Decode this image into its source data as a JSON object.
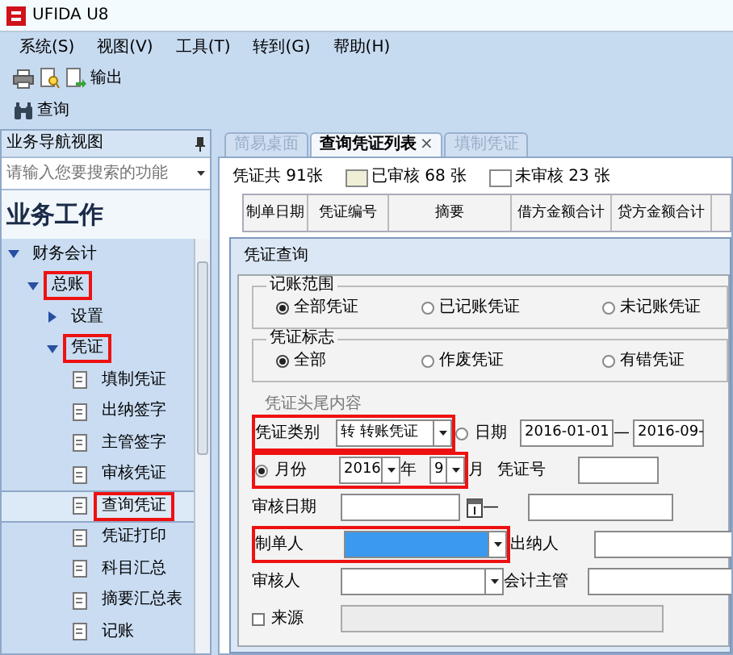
{
  "window": {
    "title": "UFIDA U8"
  },
  "menu": [
    "系统(S)",
    "视图(V)",
    "工具(T)",
    "转到(G)",
    "帮助(H)"
  ],
  "toolbar": [
    {
      "kind": "print"
    },
    {
      "kind": "preview"
    },
    {
      "kind": "export",
      "label": "输出"
    }
  ],
  "toolbar2": [
    {
      "kind": "find",
      "label": "查询"
    }
  ],
  "nav": {
    "title": "业务导航视图",
    "search_placeholder": "请输入您要搜索的功能",
    "section": "业务工作",
    "tree": [
      {
        "kind": "folder",
        "label": "财务会计",
        "expanded": true,
        "highlighted": false,
        "children": [
          {
            "kind": "folder",
            "label": "总账",
            "expanded": true,
            "highlighted": true,
            "children": [
              {
                "kind": "folder",
                "label": "设置",
                "expanded": false,
                "highlighted": false
              },
              {
                "kind": "folder",
                "label": "凭证",
                "expanded": true,
                "highlighted": true,
                "children": [
                  {
                    "kind": "item",
                    "label": "填制凭证",
                    "selected": false,
                    "highlighted": false
                  },
                  {
                    "kind": "item",
                    "label": "出纳签字",
                    "selected": false,
                    "highlighted": false
                  },
                  {
                    "kind": "item",
                    "label": "主管签字",
                    "selected": false,
                    "highlighted": false
                  },
                  {
                    "kind": "item",
                    "label": "审核凭证",
                    "selected": false,
                    "highlighted": false
                  },
                  {
                    "kind": "item",
                    "label": "查询凭证",
                    "selected": true,
                    "highlighted": true
                  },
                  {
                    "kind": "item",
                    "label": "凭证打印",
                    "selected": false,
                    "highlighted": false
                  },
                  {
                    "kind": "item",
                    "label": "科目汇总",
                    "selected": false,
                    "highlighted": false
                  },
                  {
                    "kind": "item",
                    "label": "摘要汇总表",
                    "selected": false,
                    "highlighted": false
                  },
                  {
                    "kind": "item",
                    "label": "记账",
                    "selected": false,
                    "highlighted": false
                  }
                ]
              }
            ]
          }
        ]
      }
    ]
  },
  "tabs": [
    {
      "label": "简易桌面",
      "selected": false
    },
    {
      "label": "查询凭证列表",
      "selected": true,
      "close": "×"
    },
    {
      "label": "填制凭证",
      "selected": false
    }
  ],
  "summary": {
    "total": "凭证共 91张",
    "legend": [
      {
        "label": "已审核 68 张",
        "color": "#efefd6"
      },
      {
        "label": "未审核 23 张",
        "color": "#ffffff"
      }
    ]
  },
  "table": {
    "columns": [
      "制单日期",
      "凭证编号",
      "摘要",
      "借方金额合计",
      "贷方金额合计"
    ]
  },
  "dialog": {
    "title": "凭证查询",
    "groups": [
      {
        "title": "记账范围",
        "options": [
          {
            "label": "全部凭证",
            "selected": true
          },
          {
            "label": "已记账凭证",
            "selected": false
          },
          {
            "label": "未记账凭证",
            "selected": false
          }
        ]
      },
      {
        "title": "凭证标志",
        "options": [
          {
            "label": "全部",
            "selected": true
          },
          {
            "label": "作废凭证",
            "selected": false
          },
          {
            "label": "有错凭证",
            "selected": false
          }
        ]
      }
    ],
    "content_title": "凭证头尾内容",
    "lines": [
      {
        "items": [
          {
            "kind": "label",
            "text": "凭证类别",
            "highlighted": true
          },
          {
            "kind": "select",
            "value": "转 转账凭证",
            "highlighted": true
          },
          {
            "kind": "radio",
            "label": "日期",
            "selected": false
          },
          {
            "kind": "input",
            "value": "2016-01-01"
          },
          {
            "kind": "label",
            "text": "—"
          },
          {
            "kind": "input",
            "value": "2016-09-"
          }
        ]
      },
      {
        "items": [
          {
            "kind": "radio",
            "label": "月份",
            "selected": true,
            "highlighted": true
          },
          {
            "kind": "select",
            "value": "2016",
            "highlighted": true
          },
          {
            "kind": "label",
            "text": "年",
            "highlighted": true
          },
          {
            "kind": "select",
            "value": "9",
            "highlighted": true
          },
          {
            "kind": "label",
            "text": "月"
          },
          {
            "kind": "label",
            "text": "凭证号"
          },
          {
            "kind": "input"
          }
        ]
      },
      {
        "items": [
          {
            "kind": "label",
            "text": "审核日期"
          },
          {
            "kind": "date"
          },
          {
            "kind": "label",
            "text": "—"
          },
          {
            "kind": "input"
          }
        ]
      },
      {
        "items": [
          {
            "kind": "label",
            "text": "制单人",
            "highlighted": true
          },
          {
            "kind": "select",
            "focused": true,
            "highlighted": true
          },
          {
            "kind": "label",
            "text": "出纳人"
          },
          {
            "kind": "input"
          }
        ]
      },
      {
        "items": [
          {
            "kind": "label",
            "text": "审核人"
          },
          {
            "kind": "select",
            "focused": false
          },
          {
            "kind": "label",
            "text": "会计主管"
          },
          {
            "kind": "input"
          }
        ]
      },
      {
        "items": [
          {
            "kind": "checkbox",
            "label": "来源",
            "checked": false
          },
          {
            "kind": "input",
            "disabled": true
          }
        ]
      }
    ]
  }
}
